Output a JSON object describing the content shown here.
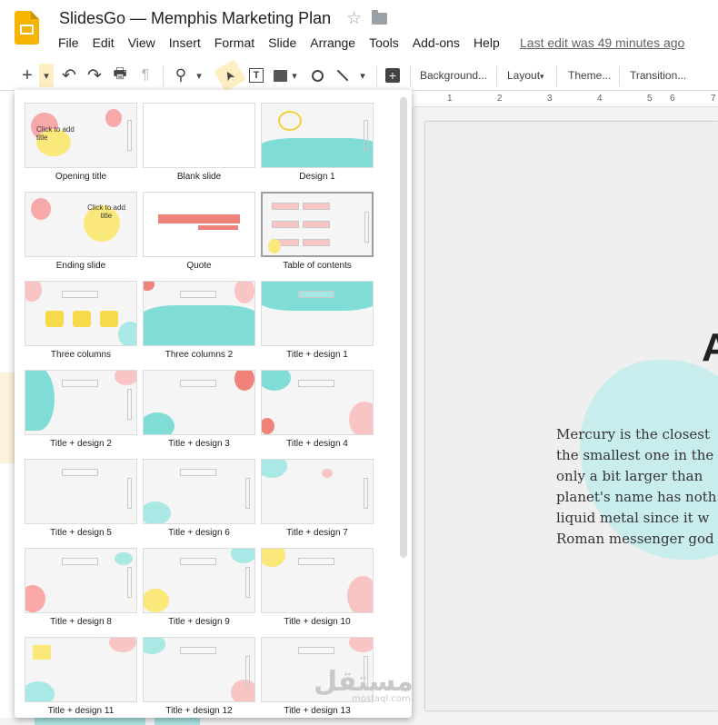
{
  "header": {
    "doc_title": "SlidesGo — Memphis Marketing Plan",
    "star_glyph": "☆",
    "last_edit": "Last edit was 49 minutes ago",
    "menu": [
      "File",
      "Edit",
      "View",
      "Insert",
      "Format",
      "Slide",
      "Arrange",
      "Tools",
      "Add-ons",
      "Help"
    ]
  },
  "toolbar": {
    "add": "+",
    "dropdown": "▾",
    "undo": "↶",
    "redo": "↷",
    "print": "🖶",
    "paint": "¶",
    "zoom": "⚲",
    "select": "➤",
    "textbox": "T",
    "comment": "+",
    "background": "Background...",
    "layout": "Layout",
    "layout_arrow": "▾",
    "theme": "Theme...",
    "transition": "Transition..."
  },
  "ruler": {
    "marks": [
      "1",
      "2",
      "3",
      "4",
      "5",
      "6",
      "7"
    ]
  },
  "slide": {
    "heading_partial": "A",
    "body_lines": [
      "Mercury is the closest",
      "the smallest one in the",
      "only a bit larger than",
      "planet's name has noth",
      "liquid metal since it w",
      "Roman messenger god"
    ]
  },
  "layouts": {
    "placeholder": "Click to add title",
    "items": [
      "Opening title",
      "Blank slide",
      "Design 1",
      "Ending slide",
      "Quote",
      "Table of contents",
      "Three columns",
      "Three columns 2",
      "Title + design 1",
      "Title + design 2",
      "Title + design 3",
      "Title + design 4",
      "Title + design 5",
      "Title + design 6",
      "Title + design 7",
      "Title + design 8",
      "Title + design 9",
      "Title + design 10",
      "Title + design 11",
      "Title + design 12",
      "Title + design 13"
    ]
  },
  "watermark": {
    "arabic": "مستقل",
    "latin": "mostaql.com"
  },
  "colors": {
    "accent_yellow": "#f4b400",
    "mint": "#7fddd6",
    "pink": "#f7a8a8",
    "yellow": "#fbe87a",
    "highlight": "#feefc3"
  }
}
